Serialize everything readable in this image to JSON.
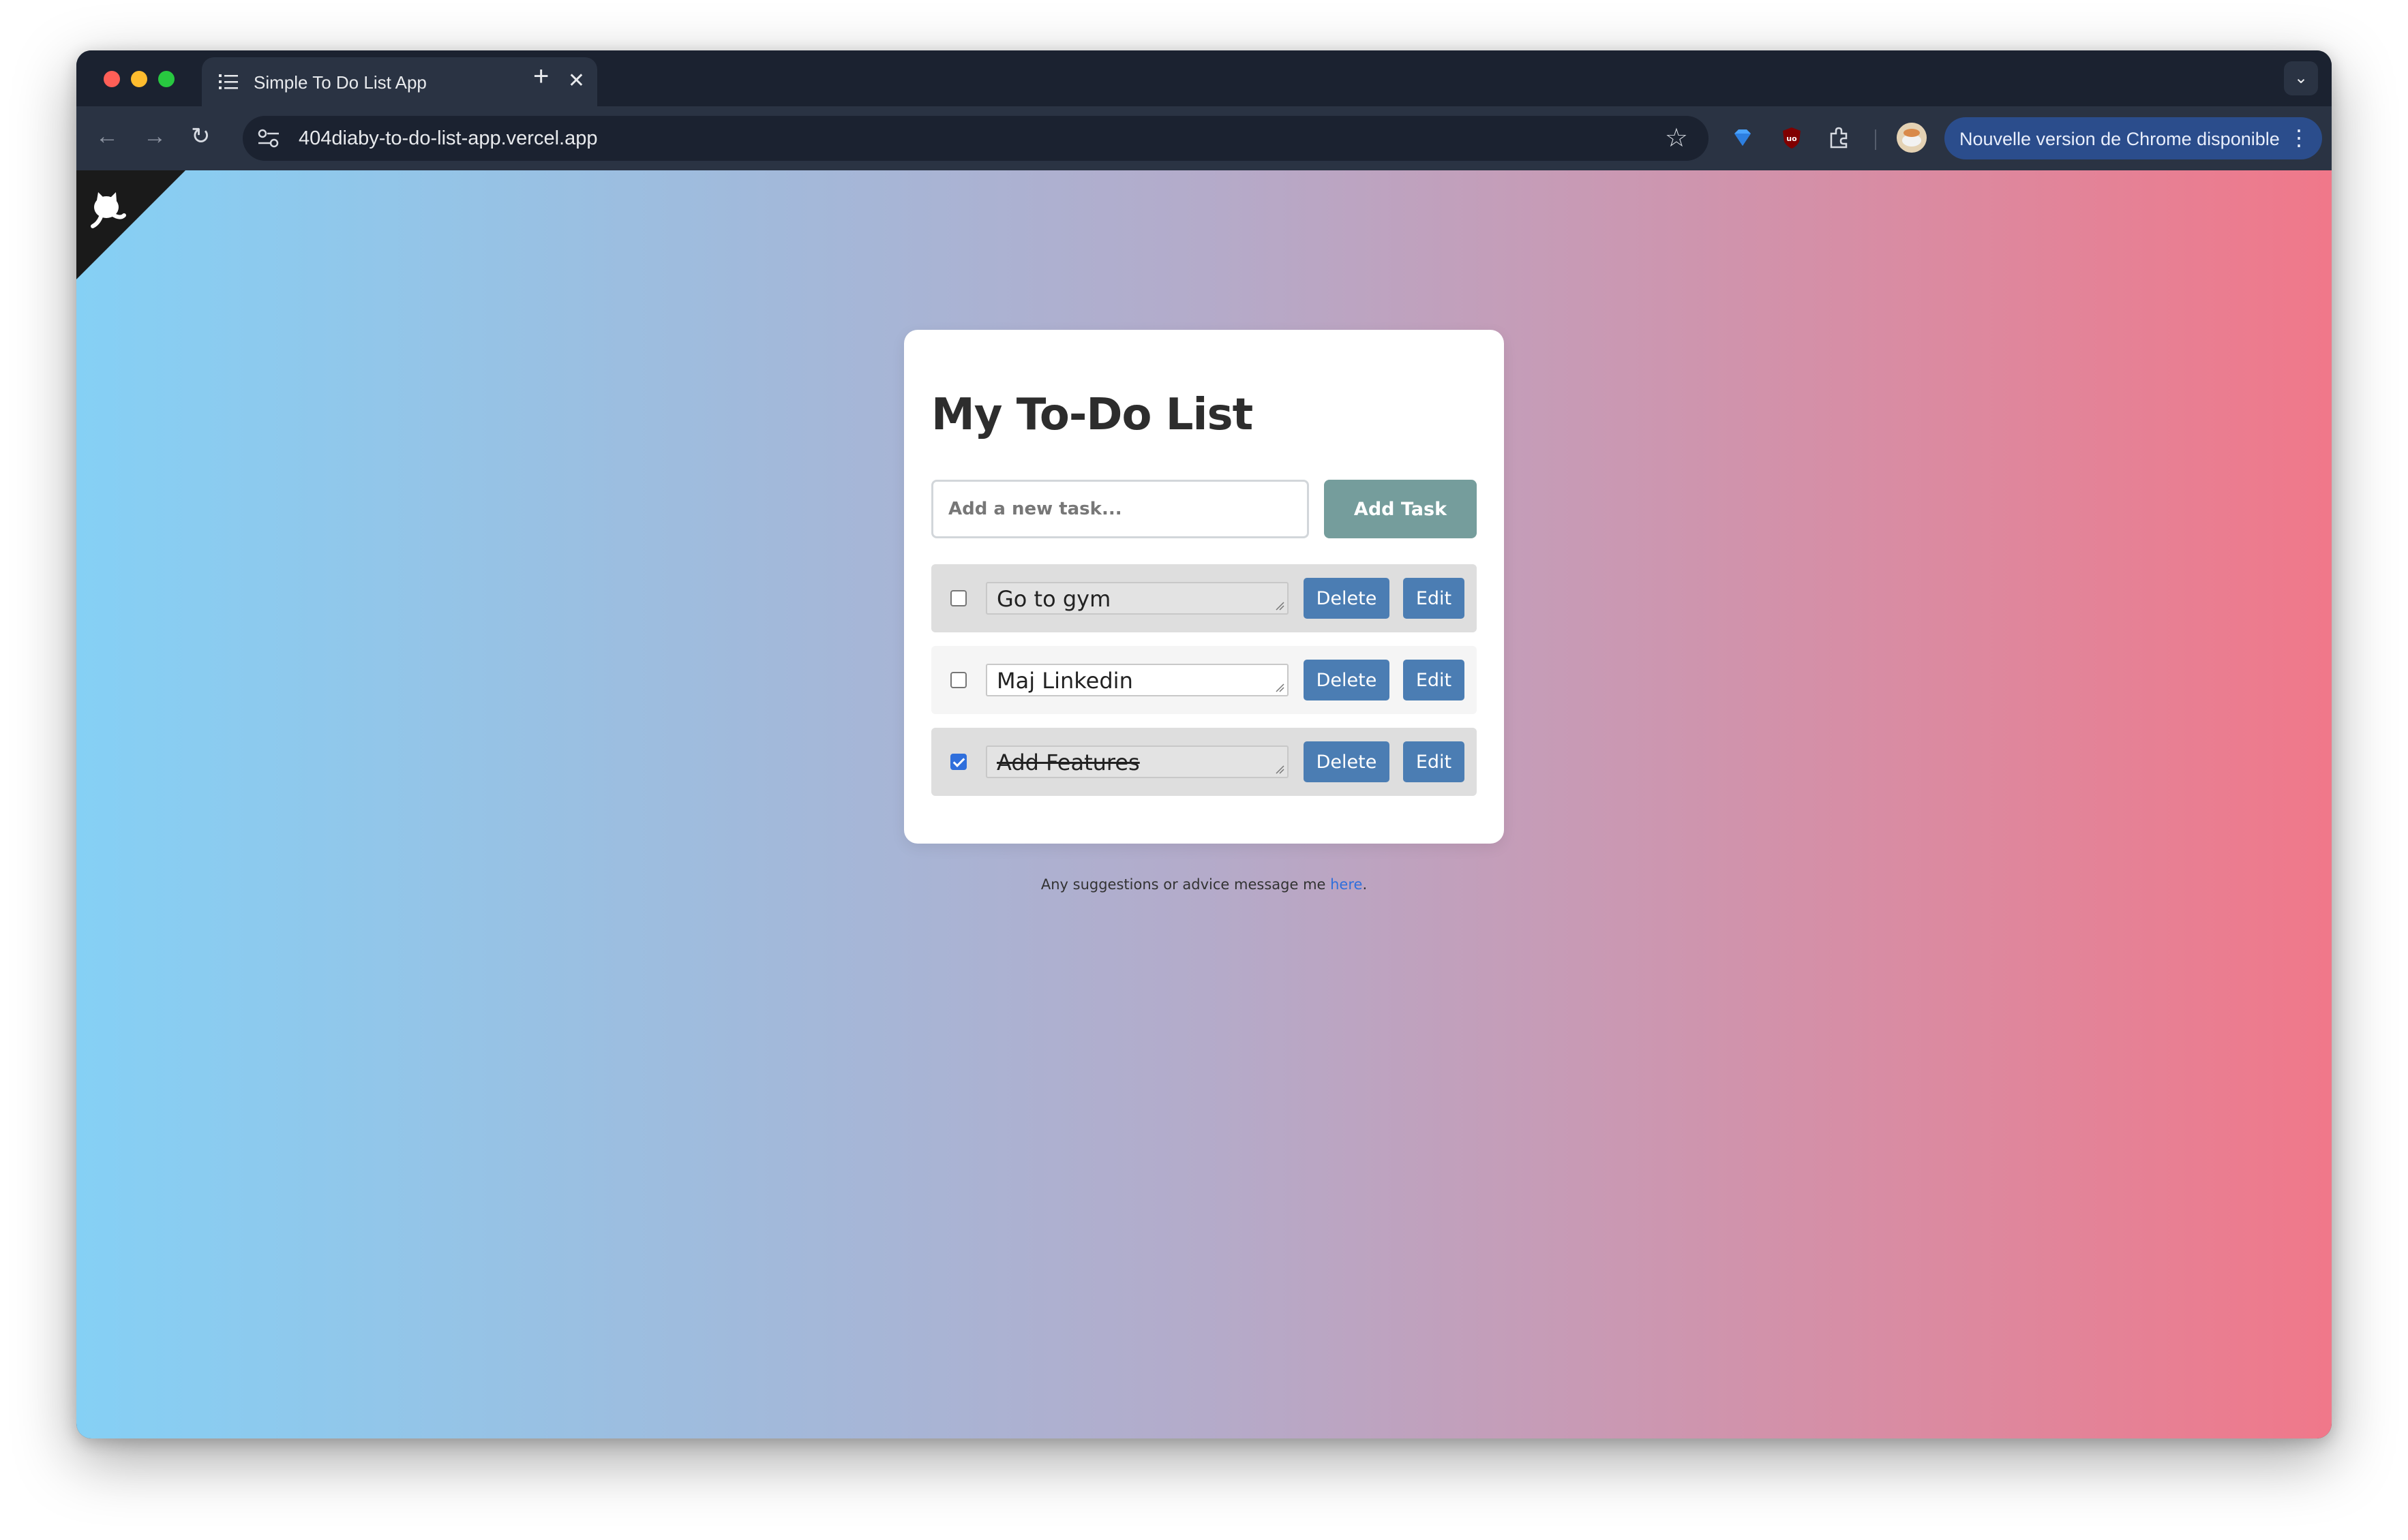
{
  "browser": {
    "tab_title": "Simple To Do List App",
    "url": "404diaby-to-do-list-app.vercel.app",
    "update_label": "Nouvelle version de Chrome disponible"
  },
  "app": {
    "title": "My To-Do List",
    "input_placeholder": "Add a new task...",
    "add_button_label": "Add Task",
    "delete_label": "Delete",
    "edit_label": "Edit",
    "tasks": [
      {
        "text": "Go to gym",
        "done": false
      },
      {
        "text": "Maj Linkedin",
        "done": false
      },
      {
        "text": "Add Features",
        "done": true
      }
    ]
  },
  "footer": {
    "text": "Any suggestions or advice message me ",
    "link_text": "here",
    "trailing": "."
  },
  "colors": {
    "gradient_left": "#85d0f5",
    "gradient_right": "#f0788a",
    "button_blue": "#4b7db3",
    "add_button": "#759d9c"
  },
  "icons": [
    "list-icon",
    "close-icon",
    "plus-icon",
    "chevron-down-icon",
    "back-icon",
    "forward-icon",
    "reload-icon",
    "site-info-icon",
    "star-icon",
    "gem-extension-icon",
    "ublock-icon",
    "puzzle-icon",
    "kebab-icon",
    "github-octocat-icon",
    "resize-handle-icon"
  ]
}
